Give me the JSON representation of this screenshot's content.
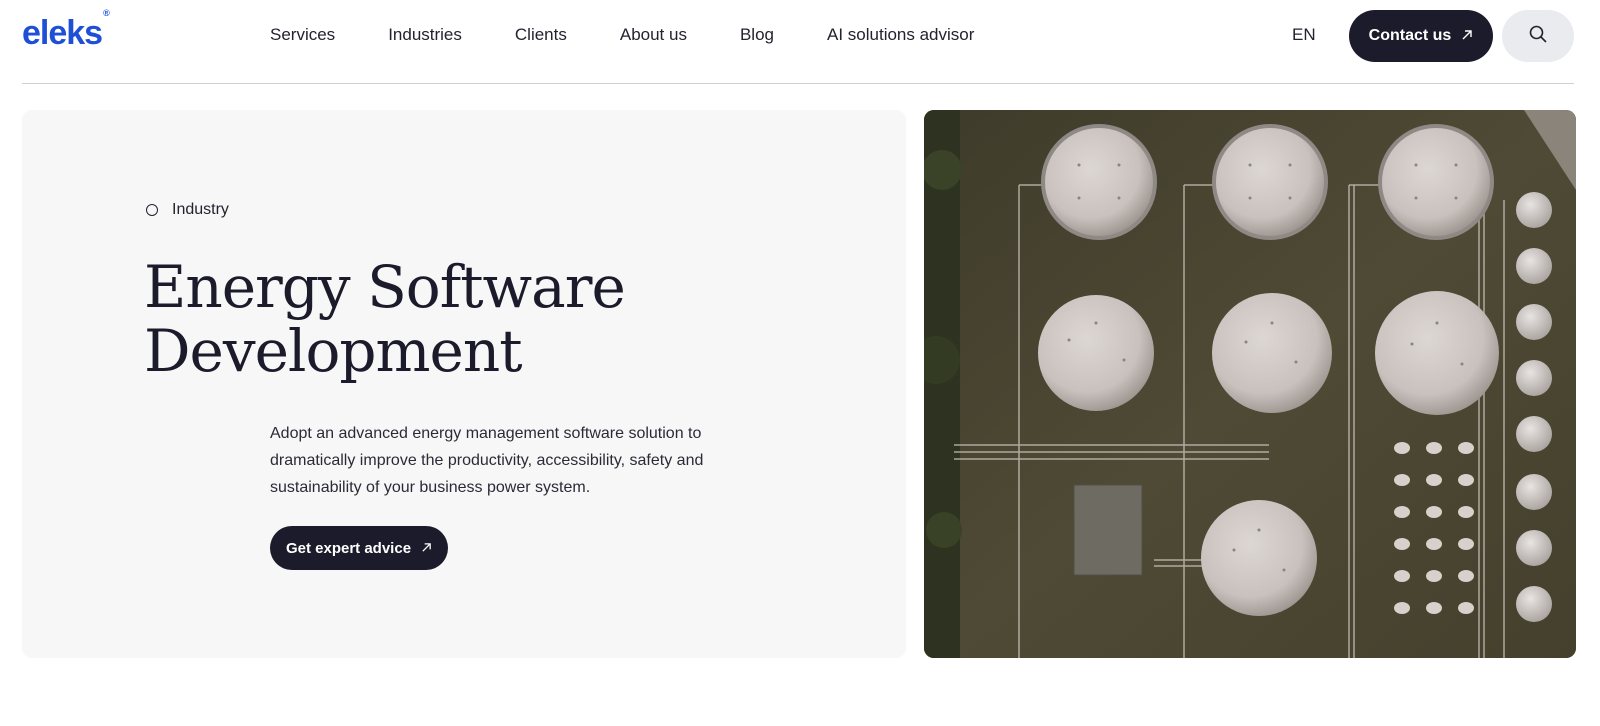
{
  "header": {
    "logo": "eleks",
    "logo_mark": "®",
    "nav": [
      {
        "label": "Services"
      },
      {
        "label": "Industries"
      },
      {
        "label": "Clients"
      },
      {
        "label": "About us"
      },
      {
        "label": "Blog"
      },
      {
        "label": "AI solutions advisor"
      }
    ],
    "language": "EN",
    "contact_label": "Contact us",
    "contact_icon": "arrow-up-right-icon",
    "search_icon": "search-icon"
  },
  "hero": {
    "tag": "Industry",
    "title_line1": "Energy Software",
    "title_line2": "Development",
    "description": "Adopt an advanced energy management software solution to dramatically improve the productivity, accessibility, safety and sustainability of your business power system.",
    "cta_label": "Get expert advice",
    "cta_icon": "arrow-up-right-icon",
    "image_subject": "aerial-view-storage-tanks"
  },
  "colors": {
    "brand": "#1f4fd6",
    "dark_button": "#1c1b2b",
    "card_bg": "#f7f7f7",
    "search_bg": "#e9ebef"
  }
}
